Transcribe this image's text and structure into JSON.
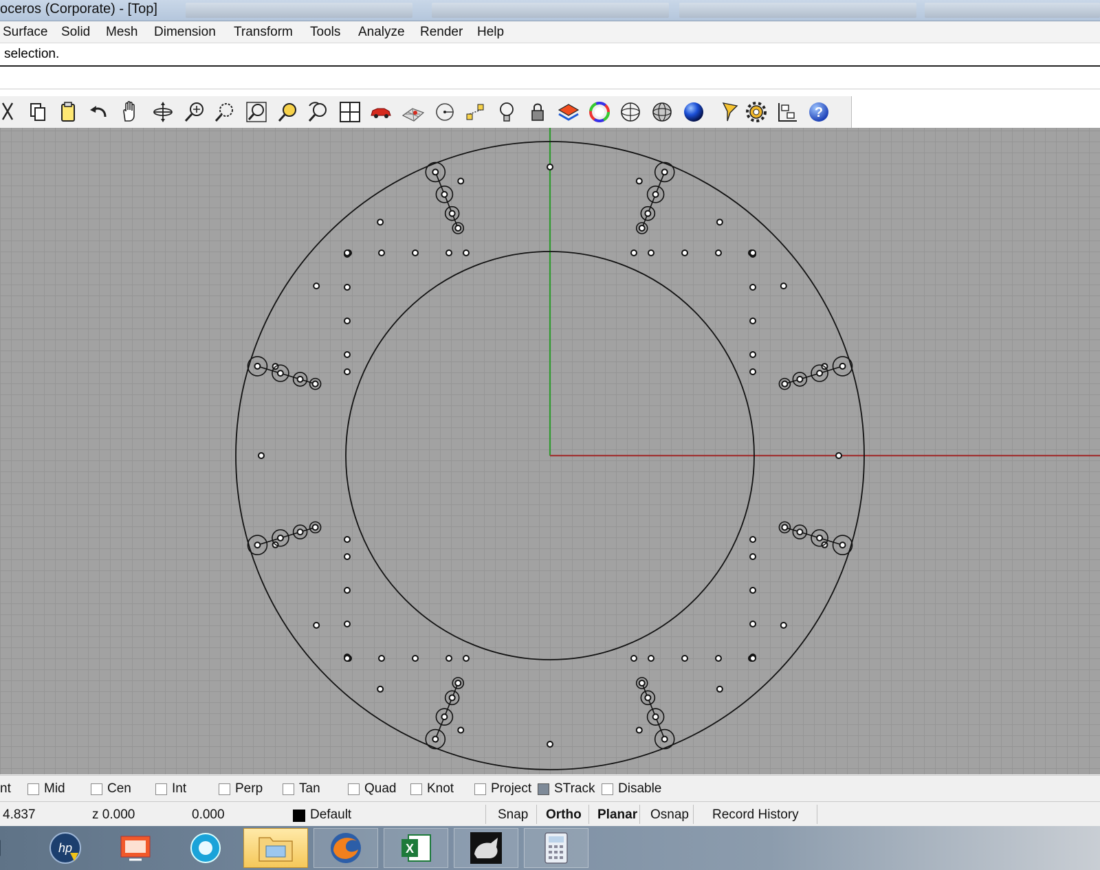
{
  "window": {
    "title": "oceros (Corporate) - [Top]"
  },
  "menu": {
    "items": [
      "Surface",
      "Solid",
      "Mesh",
      "Dimension",
      "Transform",
      "Tools",
      "Analyze",
      "Render",
      "Help"
    ]
  },
  "command": {
    "history_text": "selection.",
    "prompt_text": ""
  },
  "toolbar": {
    "icons": [
      "cut-icon",
      "copy-icon",
      "paste-icon",
      "undo-icon",
      "pan-hand-icon",
      "rotate-view-icon",
      "zoom-dynamic-icon",
      "zoom-window-icon",
      "zoom-extents-icon",
      "zoom-selected-icon",
      "undo-view-icon",
      "four-viewports-icon",
      "car-icon",
      "render-mesh-icon",
      "point-icon",
      "select-points-icon",
      "light-bulb-icon",
      "lock-icon",
      "layer-icon",
      "color-wheel-icon",
      "wireframe-sphere-icon",
      "ghosted-sphere-icon",
      "shaded-sphere-icon",
      "filter-icon",
      "options-gear-icon",
      "named-views-icon",
      "help-icon"
    ]
  },
  "viewport": {
    "name": "Top",
    "axis_colors": {
      "x": "#a03232",
      "y": "#2f9a2f"
    },
    "background": "#a2a2a2",
    "grid_color": "#959595"
  },
  "osnap": {
    "items": [
      {
        "label": "nt",
        "checked": false
      },
      {
        "label": "Mid",
        "checked": false
      },
      {
        "label": "Cen",
        "checked": false
      },
      {
        "label": "Int",
        "checked": false
      },
      {
        "label": "Perp",
        "checked": false
      },
      {
        "label": "Tan",
        "checked": false
      },
      {
        "label": "Quad",
        "checked": false
      },
      {
        "label": "Knot",
        "checked": false
      },
      {
        "label": "Project",
        "checked": false
      },
      {
        "label": "STrack",
        "checked": true
      },
      {
        "label": "Disable",
        "checked": false
      }
    ]
  },
  "status": {
    "x_coord": "4.837",
    "z_coord": "z 0.000",
    "distance": "0.000",
    "layer": "Default",
    "layer_color": "#000000",
    "snap": "Snap",
    "ortho": "Ortho",
    "planar": "Planar",
    "osnap": "Osnap",
    "record_history": "Record History"
  },
  "taskbar": {
    "apps": [
      "windows-explorer-icon",
      "hp-icon",
      "presentation-icon",
      "browser-circle-icon",
      "file-folder-icon",
      "firefox-icon",
      "excel-icon",
      "rhino-icon",
      "calculator-icon"
    ]
  }
}
